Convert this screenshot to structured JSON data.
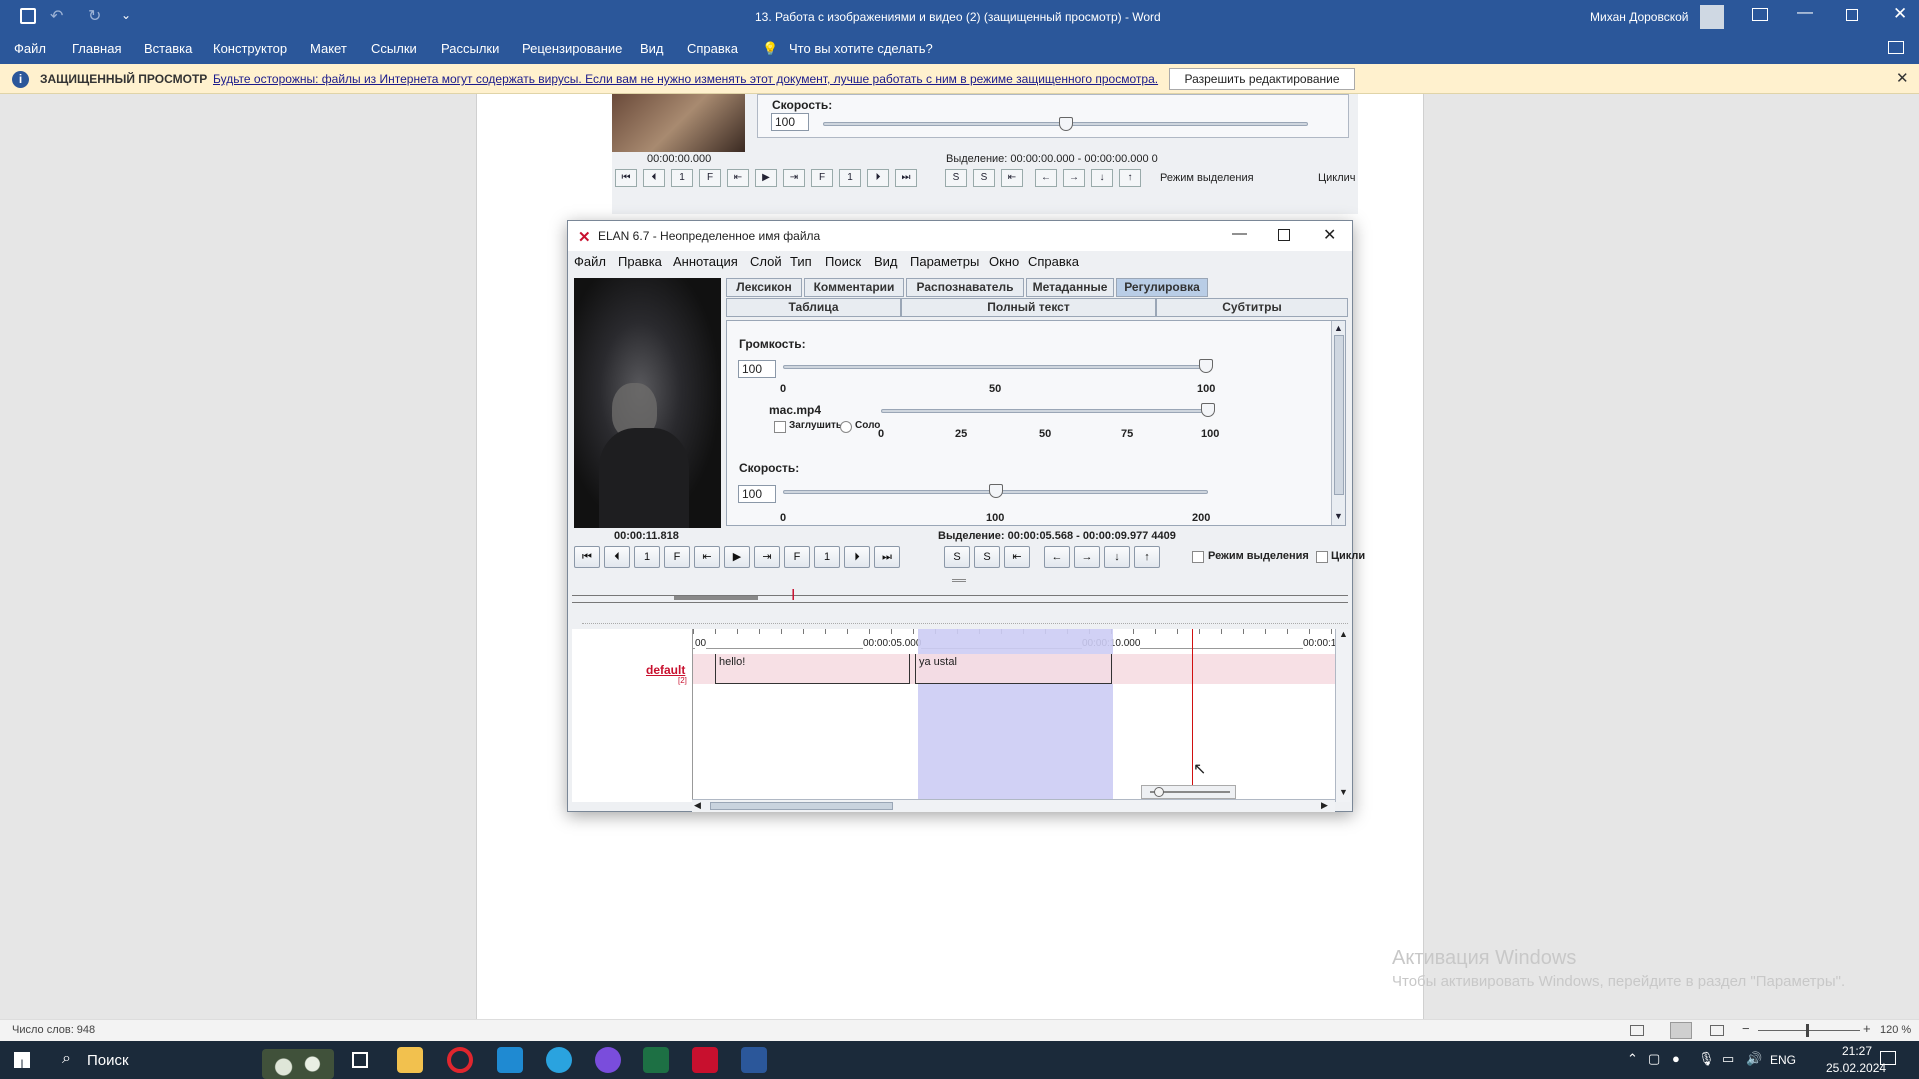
{
  "word": {
    "title": "13. Работа с изображениями и видео (2) (защищенный просмотр) - Word",
    "user": "Михан Доровской",
    "ribbon_tabs": [
      "Файл",
      "Главная",
      "Вставка",
      "Конструктор",
      "Макет",
      "Ссылки",
      "Рассылки",
      "Рецензирование",
      "Вид",
      "Справка"
    ],
    "tell_me": "Что вы хотите сделать?",
    "protected_label": "ЗАЩИЩЕННЫЙ ПРОСМОТР",
    "protected_message": "Будьте осторожны: файлы из Интернета могут содержать вирусы. Если вам не нужно изменять этот документ, лучше работать с ним в режиме защищенного просмотра.",
    "enable_editing": "Разрешить редактирование",
    "status_words": "Число слов: 948",
    "zoom": "120 %",
    "watermark_title": "Активация Windows",
    "watermark_text": "Чтобы активировать Windows, перейдите в раздел \"Параметры\"."
  },
  "bg_elan": {
    "speed_label": "Скорость:",
    "speed_value": "100",
    "time": "00:00:00.000",
    "selection": "Выделение: 00:00:00.000 - 00:00:00.000  0",
    "selection_mode": "Режим выделения",
    "loop": "Циклич"
  },
  "elan": {
    "title": "ELAN 6.7 - Неопределенное имя файла",
    "menu": [
      "Файл",
      "Правка",
      "Аннотация",
      "Слой",
      "Тип",
      "Поиск",
      "Вид",
      "Параметры",
      "Окно",
      "Справка"
    ],
    "tabs_row1": [
      "Лексикон",
      "Комментарии",
      "Распознаватель",
      "Метаданные",
      "Регулировка"
    ],
    "tabs_row2": [
      "Таблица",
      "Полный текст",
      "Субтитры"
    ],
    "volume_label": "Громкость:",
    "volume_value": "100",
    "volume_level": 1.0,
    "volume_ticks": [
      "0",
      "50",
      "100"
    ],
    "media_file": "mac.mp4",
    "media_level": 1.0,
    "mute_label": "Заглушить",
    "solo_label": "Соло",
    "media_ticks": [
      "0",
      "25",
      "50",
      "75",
      "100"
    ],
    "speed_label": "Скорость:",
    "speed_value": "100",
    "speed_level": 0.5,
    "speed_ticks": [
      "0",
      "100",
      "200"
    ],
    "time": "00:00:11.818",
    "selection": "Выделение: 00:00:05.568 - 00:00:09.977  4409",
    "selection_mode": "Режим выделения",
    "loop": "Цикли",
    "timeline_labels": [
      "00",
      "00:00:05.000",
      "00:00:10.000",
      "00:00:1"
    ],
    "tier_name": "default",
    "tier_count": "[2]",
    "annotations": [
      "hello!",
      "ya ustal"
    ]
  },
  "taskbar": {
    "search": "Поиск",
    "lang": "ENG",
    "time": "21:27",
    "date": "25.02.2024"
  }
}
